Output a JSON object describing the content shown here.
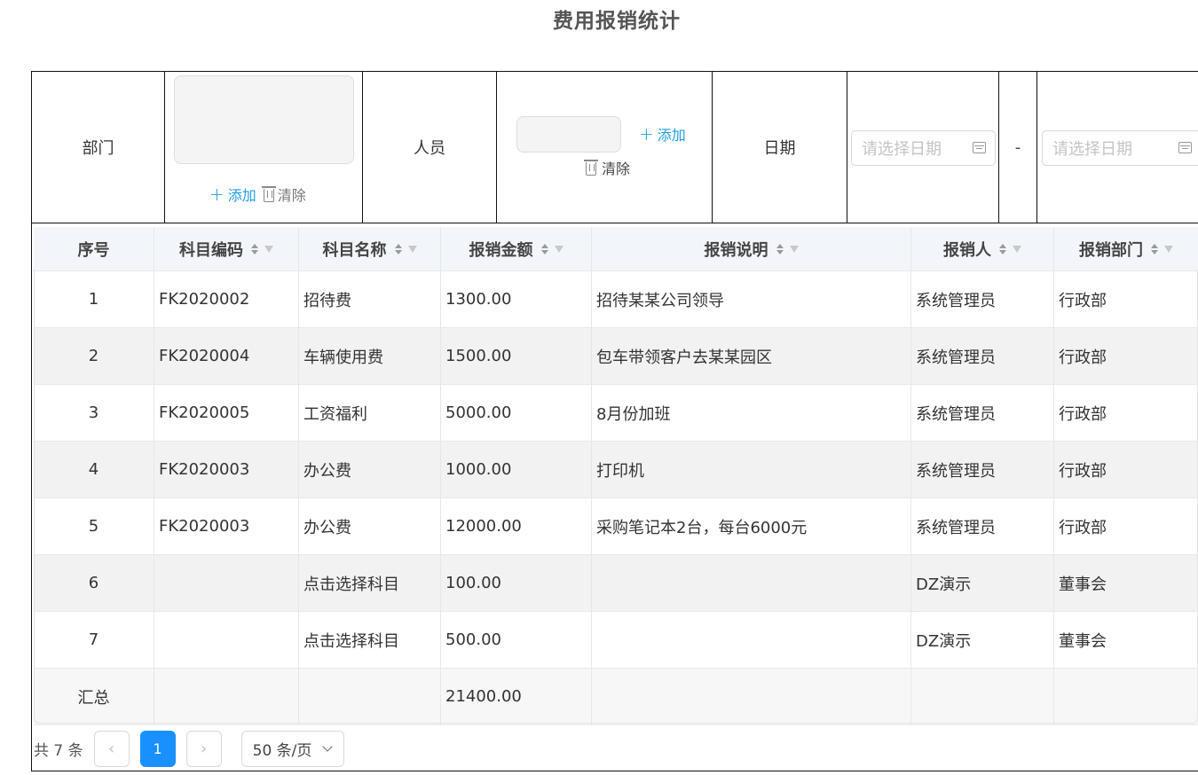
{
  "page": {
    "title": "费用报销统计"
  },
  "filter": {
    "dept_label": "部门",
    "person_label": "人员",
    "date_label": "日期",
    "add_label": "添加",
    "clear_label": "清除",
    "date_start_placeholder": "请选择日期",
    "date_end_placeholder": "请选择日期",
    "date_separator": "-"
  },
  "table": {
    "columns": [
      "序号",
      "科目编码",
      "科目名称",
      "报销金额",
      "报销说明",
      "报销人",
      "报销部门"
    ],
    "rows": [
      [
        "1",
        "FK2020002",
        "招待费",
        "1300.00",
        "招待某某公司领导",
        "系统管理员",
        "行政部"
      ],
      [
        "2",
        "FK2020004",
        "车辆使用费",
        "1500.00",
        "包车带领客户去某某园区",
        "系统管理员",
        "行政部"
      ],
      [
        "3",
        "FK2020005",
        "工资福利",
        "5000.00",
        "8月份加班",
        "系统管理员",
        "行政部"
      ],
      [
        "4",
        "FK2020003",
        "办公费",
        "1000.00",
        "打印机",
        "系统管理员",
        "行政部"
      ],
      [
        "5",
        "FK2020003",
        "办公费",
        "12000.00",
        "采购笔记本2台，每台6000元",
        "系统管理员",
        "行政部"
      ],
      [
        "6",
        "",
        "点击选择科目",
        "100.00",
        "",
        "DZ演示",
        "董事会"
      ],
      [
        "7",
        "",
        "点击选择科目",
        "500.00",
        "",
        "DZ演示",
        "董事会"
      ]
    ],
    "summary": [
      "汇总",
      "",
      "",
      "21400.00",
      "",
      "",
      ""
    ]
  },
  "pagination": {
    "total": "共 7 条",
    "prev": "‹",
    "current": "1",
    "next": "›",
    "page_size": "50 条/页"
  },
  "colors": {
    "accent": "#1890ff",
    "link": "#1e9fe0",
    "header_bg": "#f2f6fb",
    "alt_row": "#f2f2f2"
  }
}
